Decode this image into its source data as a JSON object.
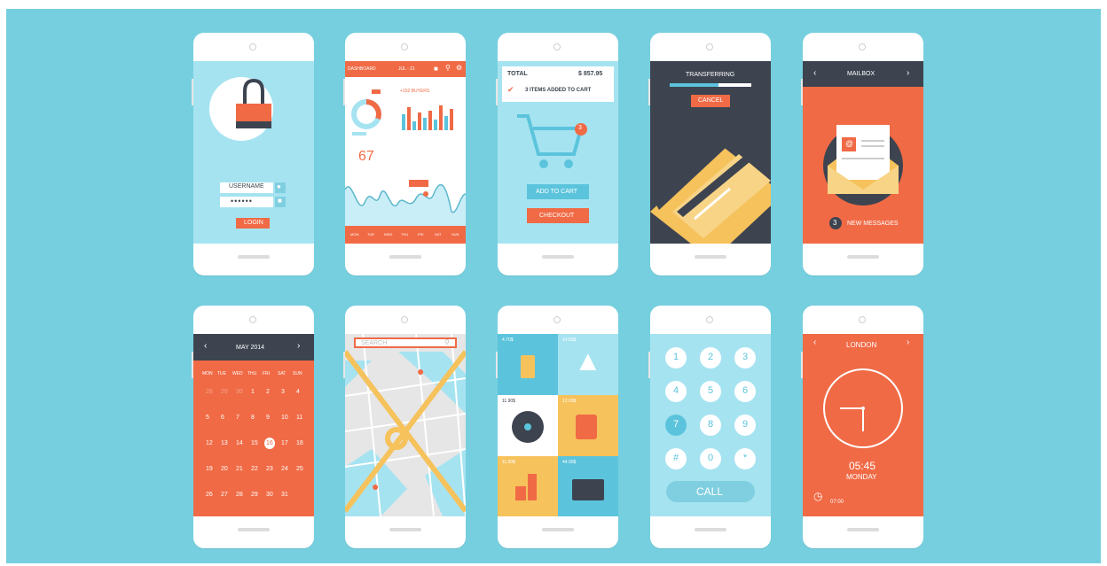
{
  "colors": {
    "background": "#76cfdf",
    "orange": "#f06a45",
    "dark": "#3d4450",
    "light_blue": "#a6e3f1",
    "yellow": "#f6c25c"
  },
  "login": {
    "username": "USERNAME",
    "password": "••••••",
    "login_button": "LOGIN",
    "icons": [
      "lock-icon",
      "user-icon",
      "key-icon"
    ]
  },
  "dashboard": {
    "title": "DASHBOARD",
    "date_range": "JUL - 21",
    "percent": "37%",
    "buyers": "+152 BUYERS",
    "count": "67",
    "days": [
      "MON",
      "TUE",
      "WED",
      "THU",
      "FRI",
      "SAT",
      "SUN"
    ]
  },
  "cart": {
    "total_label": "TOTAL",
    "total_value": "$ 857.95",
    "added": "3 ITEMS ADDED TO CART",
    "badge": "3",
    "add_button": "ADD TO CART",
    "checkout_button": "CHECKOUT"
  },
  "transfer": {
    "title": "TRANSFERRING",
    "cancel": "CANCEL",
    "progress": 0.6
  },
  "mailbox": {
    "title": "MAILBOX",
    "count": "3",
    "new_messages": "NEW MESSAGES"
  },
  "calendar": {
    "title": "MAY 2014",
    "weekdays": [
      "MON",
      "TUE",
      "WED",
      "THU",
      "FRI",
      "SAT",
      "SUN"
    ],
    "rows": [
      [
        "28",
        "29",
        "30",
        "1",
        "2",
        "3",
        "4"
      ],
      [
        "5",
        "6",
        "7",
        "8",
        "9",
        "10",
        "11"
      ],
      [
        "12",
        "13",
        "14",
        "15",
        "16",
        "17",
        "18"
      ],
      [
        "19",
        "20",
        "21",
        "22",
        "23",
        "24",
        "25"
      ],
      [
        "26",
        "27",
        "28",
        "29",
        "30",
        "31",
        ""
      ]
    ],
    "selected": "16"
  },
  "map": {
    "search_placeholder": "SEARCH"
  },
  "shop": {
    "prices": [
      "4.70$",
      "14.80$",
      "11.90$",
      "12.00$",
      "11.00$",
      "44.00$"
    ]
  },
  "dialer": {
    "keys": [
      "1",
      "2",
      "3",
      "4",
      "5",
      "6",
      "7",
      "8",
      "9",
      "#",
      "0",
      "*"
    ],
    "call": "CALL"
  },
  "clock": {
    "city": "LONDON",
    "time": "05:45",
    "day": "MONDAY",
    "alarm": "07:00"
  }
}
